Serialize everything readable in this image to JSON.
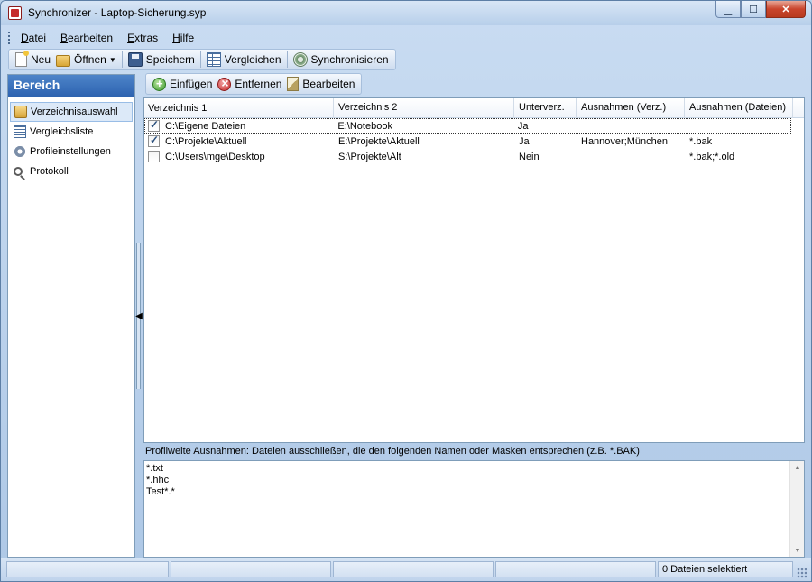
{
  "window": {
    "title": "Synchronizer - Laptop-Sicherung.syp",
    "minimize": "▁",
    "maximize": "☐",
    "close": "✕"
  },
  "menu": [
    {
      "key": "D",
      "rest": "atei"
    },
    {
      "key": "B",
      "rest": "earbeiten"
    },
    {
      "key": "E",
      "rest": "xtras"
    },
    {
      "key": "H",
      "rest": "ilfe"
    }
  ],
  "toolbar": {
    "new_label": "Neu",
    "open_label": "Öffnen",
    "save_label": "Speichern",
    "compare_label": "Vergleichen",
    "sync_label": "Synchronisieren"
  },
  "sidebar": {
    "header": "Bereich",
    "items": [
      {
        "label": "Verzeichnisauswahl",
        "icon": "folders-icon"
      },
      {
        "label": "Vergleichsliste",
        "icon": "list-icon"
      },
      {
        "label": "Profileinstellungen",
        "icon": "gear-icon"
      },
      {
        "label": "Protokoll",
        "icon": "magnifier-icon"
      }
    ]
  },
  "actions": {
    "add_label": "Einfügen",
    "remove_label": "Entfernen",
    "edit_label": "Bearbeiten"
  },
  "table": {
    "columns": [
      "Verzeichnis 1",
      "Verzeichnis 2",
      "Unterverz.",
      "Ausnahmen (Verz.)",
      "Ausnahmen (Dateien)"
    ],
    "rows": [
      {
        "checked": true,
        "dir1": "C:\\Eigene Dateien",
        "dir2": "E:\\Notebook",
        "sub": "Ja",
        "exc_dirs": "",
        "exc_files": ""
      },
      {
        "checked": true,
        "dir1": "C:\\Projekte\\Aktuell",
        "dir2": "E:\\Projekte\\Aktuell",
        "sub": "Ja",
        "exc_dirs": "Hannover;München",
        "exc_files": "*.bak"
      },
      {
        "checked": false,
        "dir1": "C:\\Users\\mge\\Desktop",
        "dir2": "S:\\Projekte\\Alt",
        "sub": "Nein",
        "exc_dirs": "",
        "exc_files": "*.bak;*.old"
      }
    ]
  },
  "exclusions": {
    "label": "Profilweite Ausnahmen: Dateien ausschließen, die den folgenden Namen oder Masken entsprechen (z.B. *.BAK)",
    "lines": [
      "*.txt",
      "*.hhc",
      "Test*.*"
    ]
  },
  "statusbar": {
    "panes": [
      "",
      "",
      "",
      "",
      "0 Dateien selektiert"
    ]
  },
  "colors": {
    "sidebar_header": "#2d63b0",
    "selection": "#dce9f8",
    "frame": "#7f9db9"
  }
}
